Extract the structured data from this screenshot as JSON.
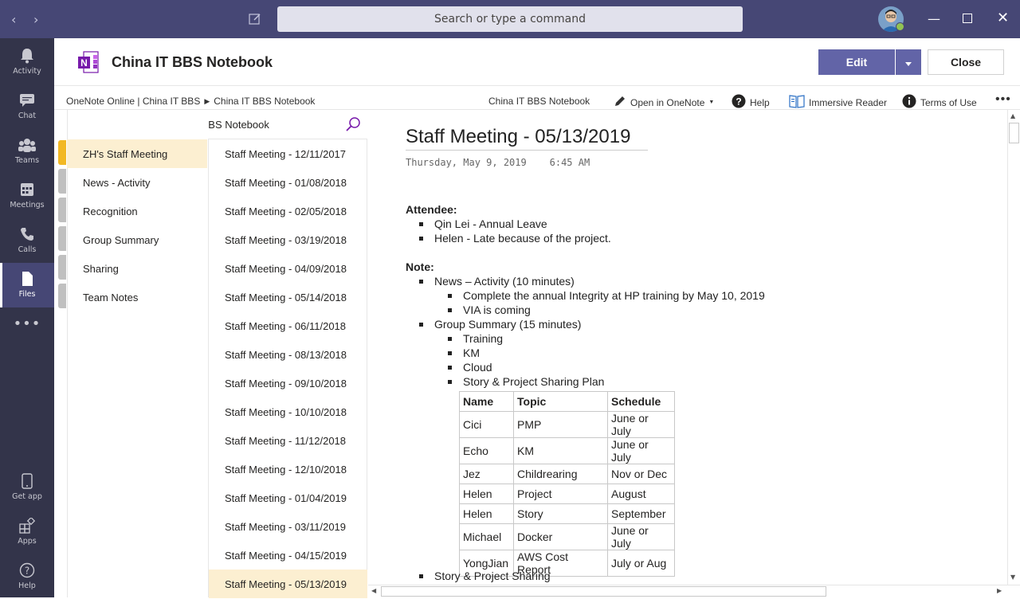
{
  "titlebar": {
    "search_placeholder": "Search or type a command"
  },
  "rail": [
    {
      "label": "Activity",
      "icon": "bell-icon"
    },
    {
      "label": "Chat",
      "icon": "chat-icon"
    },
    {
      "label": "Teams",
      "icon": "teams-icon"
    },
    {
      "label": "Meetings",
      "icon": "calendar-icon"
    },
    {
      "label": "Calls",
      "icon": "phone-icon"
    },
    {
      "label": "Files",
      "icon": "file-icon",
      "active": true
    },
    {
      "label": "",
      "icon": "more-icon"
    },
    {
      "label": "Get app",
      "icon": "mobile-icon"
    },
    {
      "label": "Apps",
      "icon": "apps-icon"
    },
    {
      "label": "Help",
      "icon": "help-icon"
    }
  ],
  "header": {
    "title": "China IT BBS Notebook",
    "edit_label": "Edit",
    "close_label": "Close"
  },
  "toolbar": {
    "breadcrumb_1": "OneNote Online | China IT BBS",
    "breadcrumb_2": "China IT BBS Notebook",
    "notebook": "China IT BBS Notebook",
    "open_in": "Open in OneNote",
    "help": "Help",
    "immersive": "Immersive Reader",
    "terms": "Terms of Use"
  },
  "navigator": {
    "notebook_name": "China IT BBS Notebook",
    "sections": [
      "ZH's Staff Meeting",
      "News - Activity",
      "Recognition",
      "Group Summary",
      "Sharing",
      "Team Notes"
    ],
    "pages": [
      "Staff Meeting - 12/11/2017",
      "Staff Meeting - 01/08/2018",
      "Staff Meeting - 02/05/2018",
      "Staff Meeting - 03/19/2018",
      "Staff Meeting - 04/09/2018",
      "Staff Meeting - 05/14/2018",
      "Staff Meeting - 06/11/2018",
      "Staff Meeting - 08/13/2018",
      "Staff Meeting - 09/10/2018",
      "Staff Meeting - 10/10/2018",
      "Staff Meeting - 11/12/2018",
      "Staff Meeting - 12/10/2018",
      "Staff Meeting - 01/04/2019",
      "Staff Meeting - 03/11/2019",
      "Staff Meeting - 04/15/2019",
      "Staff Meeting - 05/13/2019"
    ]
  },
  "page": {
    "title": "Staff Meeting - 05/13/2019",
    "date": "Thursday, May 9, 2019",
    "time": "6:45 AM",
    "attendee_heading": "Attendee:",
    "attendees": [
      "Qin Lei  - Annual Leave",
      "Helen - Late because of the project."
    ],
    "note_heading": "Note:",
    "news": "News – Activity (10 minutes)",
    "news_items": [
      "Complete the annual Integrity at HP training by May 10, 2019",
      "VIA is coming"
    ],
    "group": "Group Summary (15 minutes)",
    "group_items": [
      "Training",
      "KM",
      "Cloud",
      "Story & Project Sharing  Plan"
    ],
    "table_headers": [
      "Name",
      "Topic",
      "Schedule"
    ],
    "table_rows": [
      [
        "Cici",
        "PMP",
        "June or July"
      ],
      [
        "Echo",
        "KM",
        "June or July"
      ],
      [
        "Jez",
        "Childrearing",
        "Nov or Dec"
      ],
      [
        "Helen",
        "Project",
        "August"
      ],
      [
        "Helen",
        "Story",
        "September"
      ],
      [
        "Michael",
        "Docker",
        "June or July"
      ],
      [
        "YongJian",
        "AWS Cost Report",
        "July or Aug"
      ]
    ],
    "last_item": "Story & Project Sharing"
  },
  "colors": {
    "titlebar": "#464775",
    "rail": "#33344a",
    "accent": "#6264a7",
    "selected": "#fcefd1",
    "section_tab_active": "#f2b824"
  }
}
